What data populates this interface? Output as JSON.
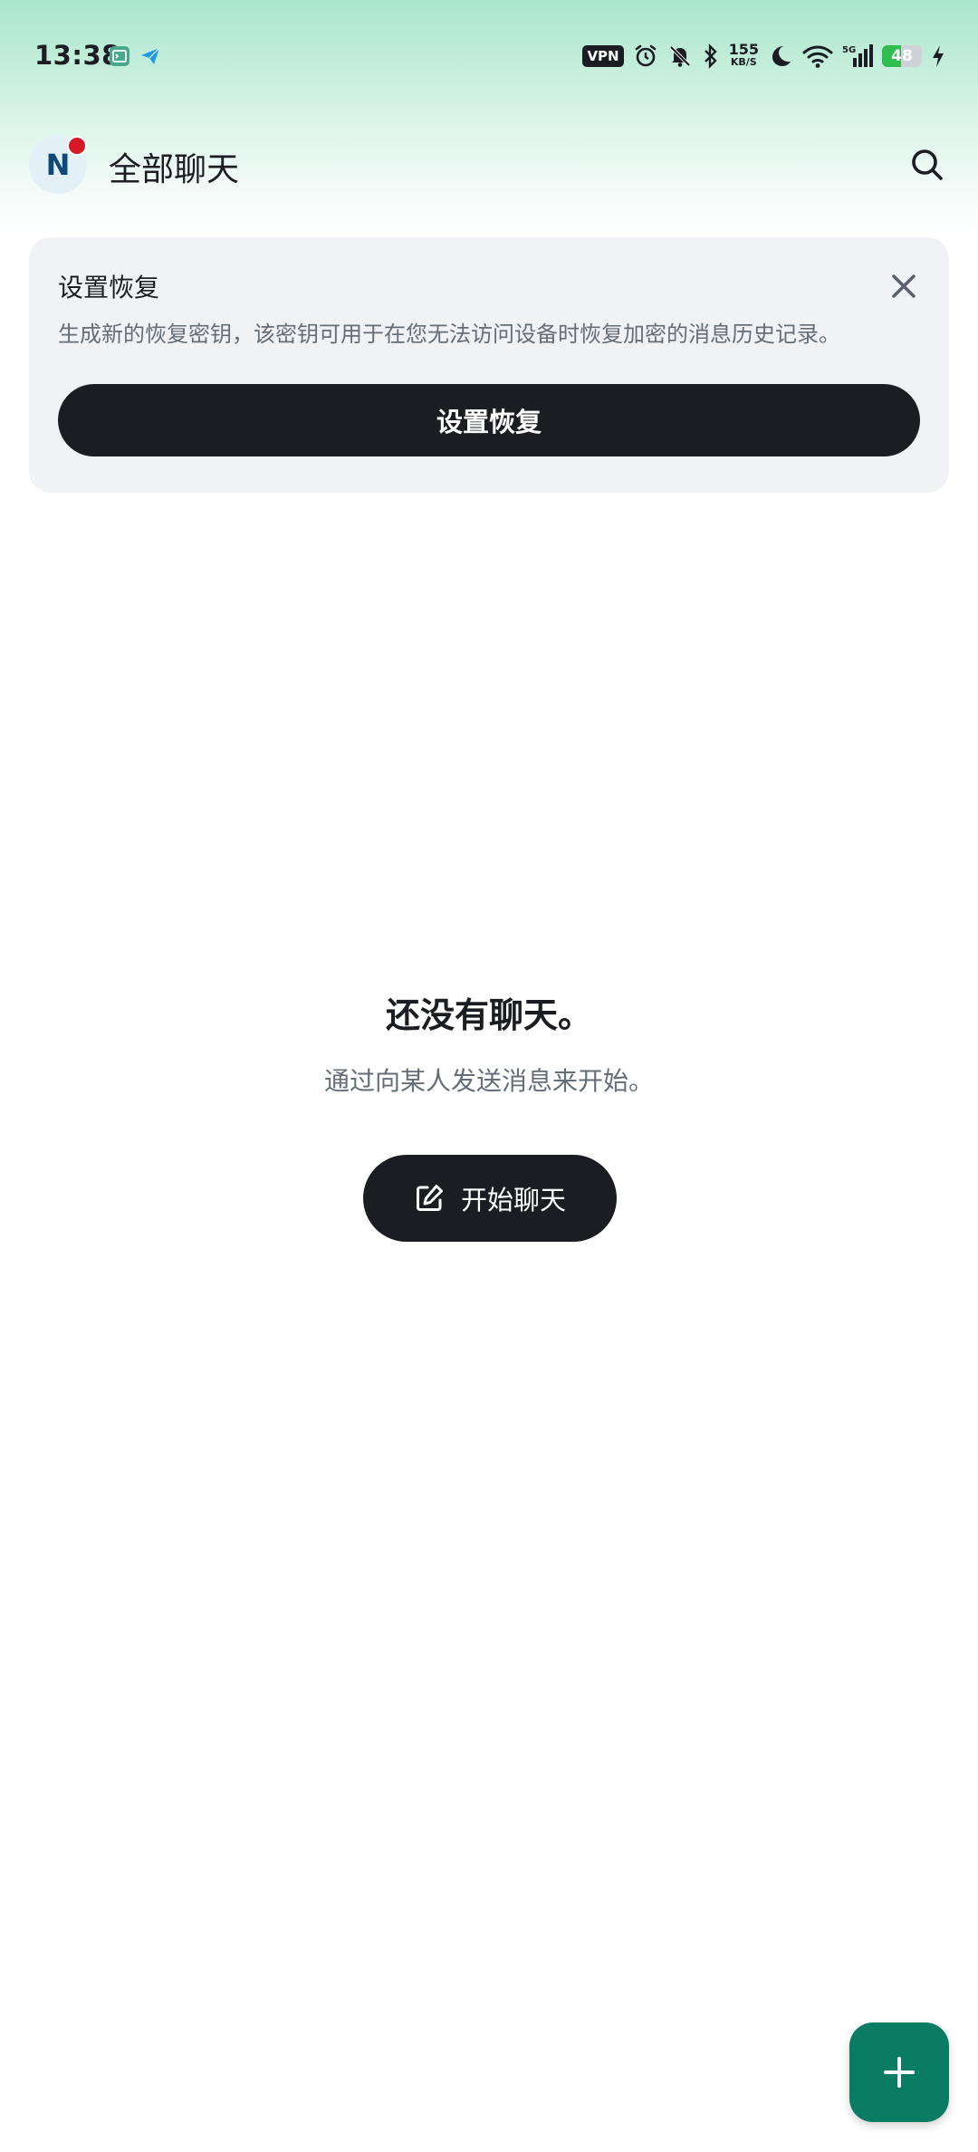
{
  "status_bar": {
    "time": "13:38",
    "vpn_label": "VPN",
    "network_speed": "155",
    "network_speed_unit": "KB/S",
    "network_type": "5G",
    "battery_level": "48"
  },
  "header": {
    "avatar_letter": "N",
    "title": "全部聊天"
  },
  "recovery_card": {
    "title": "设置恢复",
    "description": "生成新的恢复密钥，该密钥可用于在您无法访问设备时恢复加密的消息历史记录。",
    "button_label": "设置恢复"
  },
  "empty_state": {
    "title": "还没有聊天。",
    "subtitle": "通过向某人发送消息来开始。",
    "button_label": "开始聊天"
  },
  "colors": {
    "accent": "#0a7c63",
    "dark_button": "#1b1d22",
    "notification_dot": "#d51928",
    "battery_fill": "#2ebd4e"
  }
}
